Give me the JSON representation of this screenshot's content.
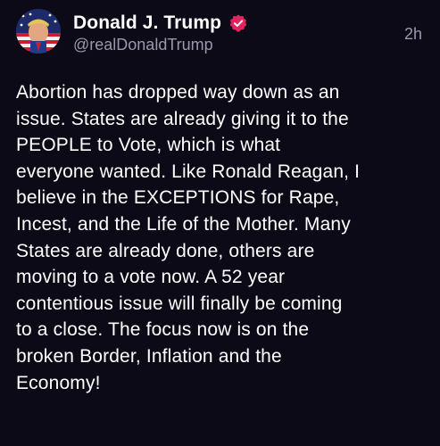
{
  "author": {
    "display_name": "Donald J. Trump",
    "handle": "@realDonaldTrump",
    "verified": true,
    "avatar_icon": "american-flag-portrait-avatar"
  },
  "post": {
    "timestamp": "2h",
    "text": "Abortion has dropped way down as an\nissue. States are already giving it to the\nPEOPLE to Vote, which is what\neveryone wanted. Like Ronald Reagan, I\nbelieve in the EXCEPTIONS for Rape,\nIncest, and the Life of the Mother. Many\nStates are already done, others are\nmoving to a vote now. A 52 year\ncontentious issue will finally be coming\nto a close. The focus now is on the\nbroken Border, Inflation and the\nEconomy!"
  },
  "colors": {
    "background": "#0b0a16",
    "text": "#ffffff",
    "muted": "#9b98ad",
    "verified_badge": "#e0245e"
  }
}
